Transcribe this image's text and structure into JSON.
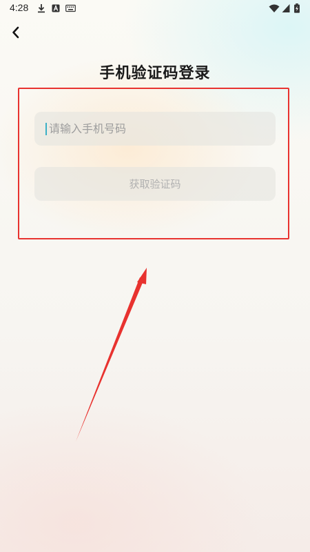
{
  "status_bar": {
    "time": "4:28",
    "icons": [
      "download-icon",
      "a-icon",
      "keyboard-icon",
      "wifi-icon",
      "signal-icon",
      "battery-icon"
    ]
  },
  "header": {
    "back_icon": "chevron-left-icon",
    "title": "手机验证码登录"
  },
  "form": {
    "phone_placeholder": "请输入手机号码",
    "phone_value": "",
    "get_code_label": "获取验证码"
  },
  "annotation": {
    "color": "#e8322f"
  }
}
